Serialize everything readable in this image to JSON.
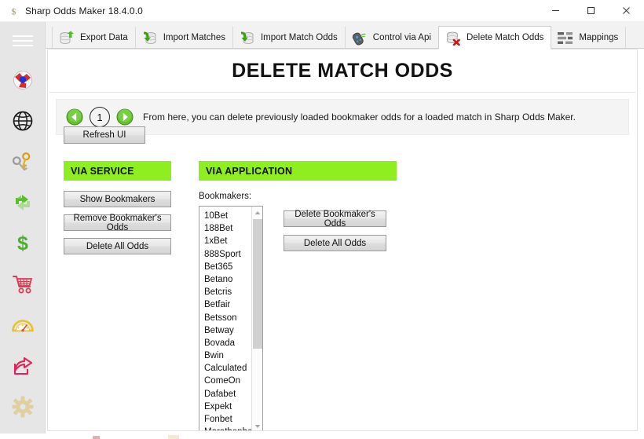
{
  "window": {
    "title": "Sharp Odds Maker 18.4.0.0",
    "icon": "dollar-icon",
    "minimize_label": "─",
    "maximize_label": "□",
    "close_label": "✕"
  },
  "sidebar": {
    "items": [
      {
        "name": "menu",
        "icon": "hamburger-menu-icon"
      },
      {
        "name": "football",
        "icon": "soccer-ball-icon"
      },
      {
        "name": "globe",
        "icon": "globe-icon"
      },
      {
        "name": "keys",
        "icon": "keys-icon"
      },
      {
        "name": "sync",
        "icon": "sync-arrows-icon"
      },
      {
        "name": "money",
        "icon": "dollar-sign-icon"
      },
      {
        "name": "cart",
        "icon": "shopping-cart-icon"
      },
      {
        "name": "gauge",
        "icon": "speedometer-icon"
      },
      {
        "name": "share",
        "icon": "share-icon"
      },
      {
        "name": "settings",
        "icon": "gear-icon"
      }
    ]
  },
  "tabs": [
    {
      "label": "Export Data",
      "icon": "database-up-arrow-icon",
      "active": false
    },
    {
      "label": "Import Matches",
      "icon": "database-down-arrow-icon",
      "active": false
    },
    {
      "label": "Import Match Odds",
      "icon": "database-down-arrow-icon",
      "active": false
    },
    {
      "label": "Control via Api",
      "icon": "remote-control-signal-icon",
      "active": false
    },
    {
      "label": "Delete Match Odds",
      "icon": "database-red-x-icon",
      "active": true
    },
    {
      "label": "Mappings",
      "icon": "mappings-sliders-icon",
      "active": false
    }
  ],
  "page": {
    "title": "DELETE MATCH ODDS",
    "banner": {
      "back_icon": "arrow-left-circle-icon",
      "step_number": "1",
      "forward_icon": "arrow-right-circle-icon",
      "text": "From here, you can delete previously loaded bookmaker odds for a loaded match in Sharp Odds Maker."
    },
    "refresh_button": "Refresh UI",
    "via_service": {
      "heading": "VIA SERVICE",
      "buttons": [
        "Show Bookmakers",
        "Remove Bookmaker's Odds",
        "Delete All Odds"
      ]
    },
    "via_application": {
      "heading": "VIA APPLICATION",
      "bookmakers_label": "Bookmakers:",
      "bookmakers": [
        "10Bet",
        "188Bet",
        "1xBet",
        "888Sport",
        "Bet365",
        "Betano",
        "Betcris",
        "Betfair",
        "Betsson",
        "Betway",
        "Bovada",
        "Bwin",
        "Calculated",
        "ComeOn",
        "Dafabet",
        "Expekt",
        "Fonbet",
        "Marathonbet"
      ],
      "buttons": [
        "Delete Bookmaker's Odds",
        "Delete All Odds"
      ]
    }
  },
  "colors": {
    "green_header": "#8FEE1F",
    "sidebar_bg": "#e6e6e6",
    "banner_bg": "#f4f4f4",
    "accent_red": "#cc0000"
  }
}
